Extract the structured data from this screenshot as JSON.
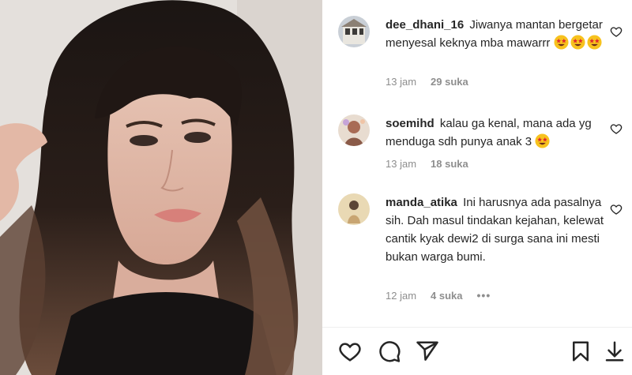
{
  "post": {
    "photo_description_icon": "portrait-photo"
  },
  "comments": [
    {
      "username": "dee_dhani_16",
      "text": "Jiwanya mantan bergetar menyesal keknya mba mawarrr",
      "emoji": "star-struck",
      "emoji_count": 3,
      "time": "13 jam",
      "likes": "29 suka",
      "more": ""
    },
    {
      "username": "soemihd",
      "text": "kalau ga kenal, mana ada yg menduga sdh punya anak 3",
      "emoji": "star-struck",
      "emoji_count": 1,
      "time": "13 jam",
      "likes": "18 suka",
      "more": ""
    },
    {
      "username": "manda_atika",
      "text": "Ini harusnya ada pasalnya sih. Dah masul tindakan kejahan, kelewat cantik kyak dewi2 di surga sana ini mesti bukan warga bumi.",
      "emoji": "",
      "emoji_count": 0,
      "time": "12 jam",
      "likes": "4 suka",
      "more": "•••"
    }
  ],
  "actions": {
    "like_icon": "heart-icon",
    "comment_icon": "comment-icon",
    "share_icon": "send-icon",
    "save_icon": "bookmark-icon",
    "download_icon": "download-icon"
  },
  "colors": {
    "text": "#262626",
    "meta": "#8e8e8e",
    "divider": "#efefef"
  }
}
